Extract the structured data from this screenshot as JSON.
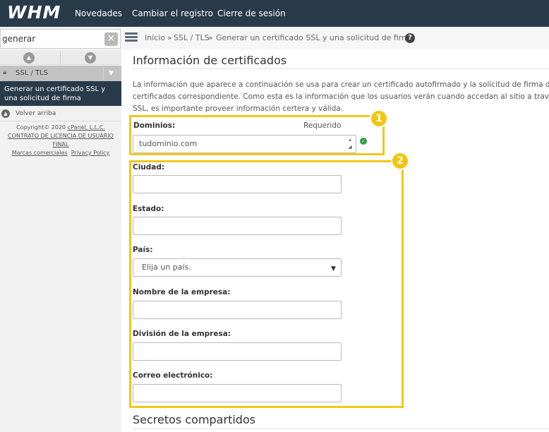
{
  "topbar": {
    "logo": "WHM",
    "nav": [
      "Novedades",
      "Cambiar el registro",
      "Cierre de sesión"
    ]
  },
  "sidebar": {
    "search_value": "generar",
    "category": "SSL / TLS",
    "active_item": "Generar un certificado SSL y una solicitud de firma",
    "back_to_top": "Volver arriba",
    "copyright_line": "Copyright© 2020 ",
    "copyright_link": "cPanel, L.L.C.",
    "license_link": "CONTRATO DE LICENCIA DE USUARIO FINAL",
    "trademarks_link": "Marcas comerciales",
    "privacy_link": "Privacy Policy"
  },
  "breadcrumb": {
    "items": [
      "Inicio",
      "»",
      "SSL / TLS",
      "»",
      "Generar un certificado SSL y una solicitud de firma"
    ]
  },
  "section": {
    "title": "Información de certificados",
    "description_lines": [
      "La información que aparece a continuación se usa para crear un certificado autofirmado y la solicitud de firma de",
      "certificados correspondiente. Como esta es la información que los usuarios verán cuando accedan al sitio a través de",
      "SSL, es importante proveer información certera y válida."
    ]
  },
  "form": {
    "domains_label": "Dominios:",
    "required_label": "Requerido",
    "domains_value": "tudominio.com",
    "city_label": "Ciudad:",
    "state_label": "Estado:",
    "country_label": "País:",
    "country_selected": "Elija un país.",
    "company_label": "Nombre de la empresa:",
    "division_label": "División de la empresa:",
    "email_label": "Correo electrónico:"
  },
  "annotations": {
    "badge_1": "1",
    "badge_2": "2",
    "highlight_color": "#f0c81a"
  },
  "next_section": {
    "title": "Secretos compartidos"
  }
}
